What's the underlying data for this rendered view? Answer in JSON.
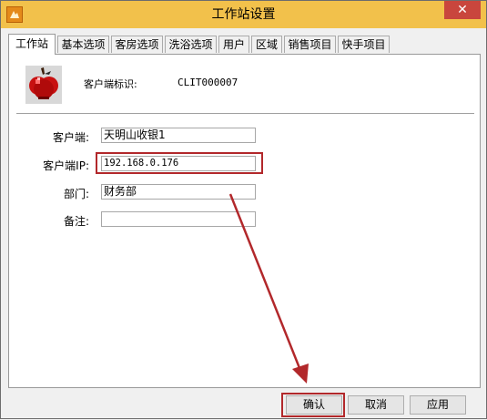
{
  "window": {
    "title": "工作站设置",
    "close_label": "✕",
    "app_icon": "app-icon"
  },
  "tabs": [
    {
      "label": "工作站",
      "active": true
    },
    {
      "label": "基本选项"
    },
    {
      "label": "客房选项"
    },
    {
      "label": "洗浴选项"
    },
    {
      "label": "用户"
    },
    {
      "label": "区域"
    },
    {
      "label": "销售项目"
    },
    {
      "label": "快手项目"
    }
  ],
  "header": {
    "client_id_label": "客户端标识:",
    "client_id_value": "CLIT000007",
    "icon": "apple-icon"
  },
  "form": {
    "client_label": "客户端:",
    "client_value": "天明山收银1",
    "ip_label": "客户端IP:",
    "ip_value": "192.168.0.176",
    "dept_label": "部门:",
    "dept_value": "财务部",
    "note_label": "备注:",
    "note_value": ""
  },
  "buttons": {
    "ok": "确认",
    "cancel": "取消",
    "apply": "应用"
  },
  "colors": {
    "titlebar": "#f2c14b",
    "close": "#c9463d",
    "highlight": "#b2282b"
  }
}
